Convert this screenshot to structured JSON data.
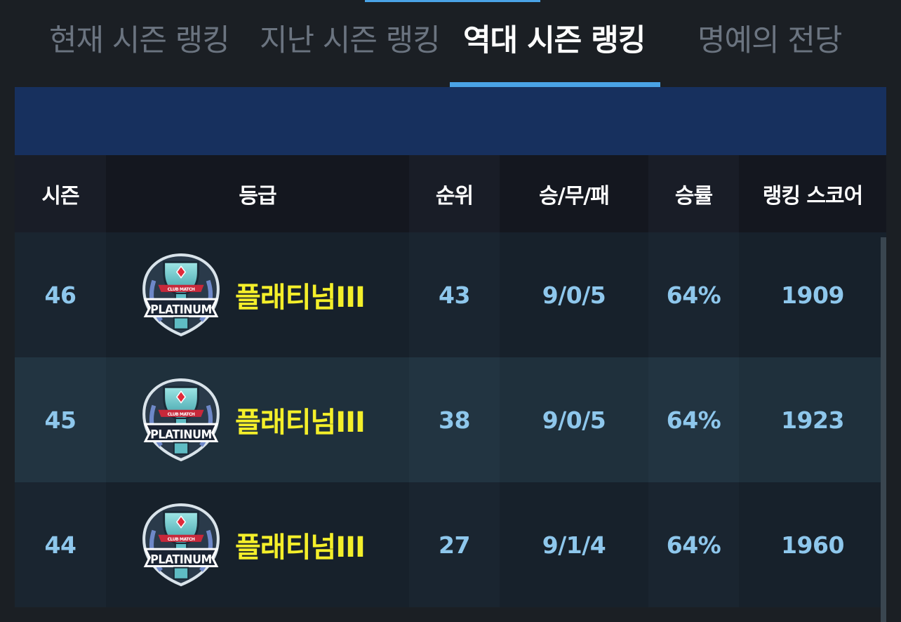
{
  "tabs": [
    {
      "label": "현재 시즌 랭킹",
      "active": false
    },
    {
      "label": "지난 시즌 랭킹",
      "active": false
    },
    {
      "label": "역대 시즌 랭킹",
      "active": true
    },
    {
      "label": "명예의 전당",
      "active": false
    }
  ],
  "table": {
    "headers": {
      "season": "시즌",
      "tier": "등급",
      "rank": "순위",
      "wdl": "승/무/패",
      "win_rate": "승률",
      "score": "랭킹 스코어"
    },
    "rows": [
      {
        "season": "46",
        "badge_text": "PLATINUM",
        "badge_ribbon": "CLUB MATCH",
        "tier": "플래티넘III",
        "rank": "43",
        "wdl": "9/0/5",
        "win_rate": "64%",
        "score": "1909"
      },
      {
        "season": "45",
        "badge_text": "PLATINUM",
        "badge_ribbon": "CLUB MATCH",
        "tier": "플래티넘III",
        "rank": "38",
        "wdl": "9/0/5",
        "win_rate": "64%",
        "score": "1923"
      },
      {
        "season": "44",
        "badge_text": "PLATINUM",
        "badge_ribbon": "CLUB MATCH",
        "tier": "플래티넘III",
        "rank": "27",
        "wdl": "9/1/4",
        "win_rate": "64%",
        "score": "1960"
      }
    ]
  },
  "icons": {
    "tier_badge": "platinum-trophy-badge-icon"
  },
  "colors": {
    "accent": "#4aa3e6",
    "tier_text": "#f4ef2a",
    "cell_text": "#8ec7ec",
    "banner": "#17305e"
  }
}
